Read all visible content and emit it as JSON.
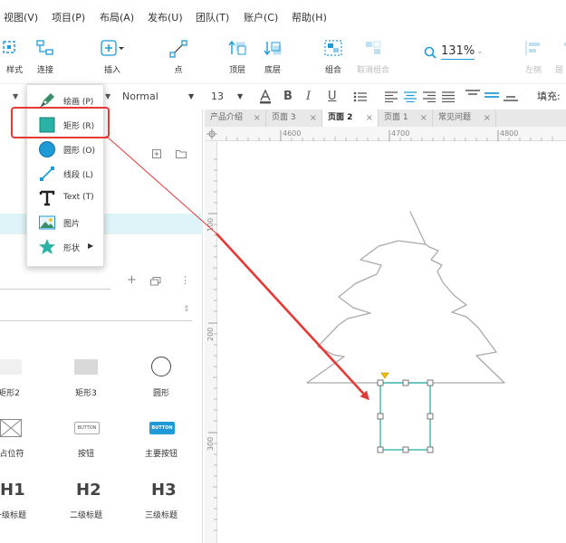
{
  "menu": [
    "视图(V)",
    "项目(P)",
    "布局(A)",
    "发布(U)",
    "团队(T)",
    "账户(C)",
    "帮助(H)"
  ],
  "toolbar": {
    "style_label": "样式",
    "connect_label": "连接",
    "insert_label": "插入",
    "point_label": "点",
    "top_layer_label": "顶层",
    "bottom_layer_label": "底层",
    "group_label": "组合",
    "ungroup_label": "取消组合",
    "zoom_value": "131%",
    "align_left_label": "左侧",
    "partial_label": "居"
  },
  "format": {
    "font_style": "Normal",
    "font_size": "13",
    "fill_label": "填充:"
  },
  "tabs": [
    {
      "label": "产品介绍",
      "active": false
    },
    {
      "label": "页面 3",
      "active": false
    },
    {
      "label": "页面 2",
      "active": true
    },
    {
      "label": "页面 1",
      "active": false
    },
    {
      "label": "常见问题",
      "active": false
    }
  ],
  "ruler": {
    "h_labels": [
      "4600",
      "4700",
      "4800"
    ],
    "v_labels": [
      "100",
      "200",
      "300"
    ]
  },
  "insert_menu": [
    {
      "label": "绘画 (P)",
      "icon": "pen-icon"
    },
    {
      "label": "矩形 (R)",
      "icon": "rectangle-icon"
    },
    {
      "label": "圆形 (O)",
      "icon": "circle-icon"
    },
    {
      "label": "线段 (L)",
      "icon": "line-icon"
    },
    {
      "label": "Text (T)",
      "icon": "text-icon"
    },
    {
      "label": "图片",
      "icon": "image-icon"
    },
    {
      "label": "形状",
      "icon": "star-icon"
    }
  ],
  "library": {
    "row1": [
      "矩形2",
      "矩形3",
      "圆形"
    ],
    "row2": [
      "占位符",
      "按钮",
      "主要按钮"
    ],
    "row3": [
      "一级标题",
      "二级标题",
      "三级标题"
    ],
    "button_text": "BUTTON",
    "h1": "H1",
    "h2": "H2",
    "h3": "H3"
  },
  "colors": {
    "accent": "#1e9bd7",
    "highlight": "#e53935",
    "selection": "#2ab3a5",
    "handle": "#f2c200"
  }
}
